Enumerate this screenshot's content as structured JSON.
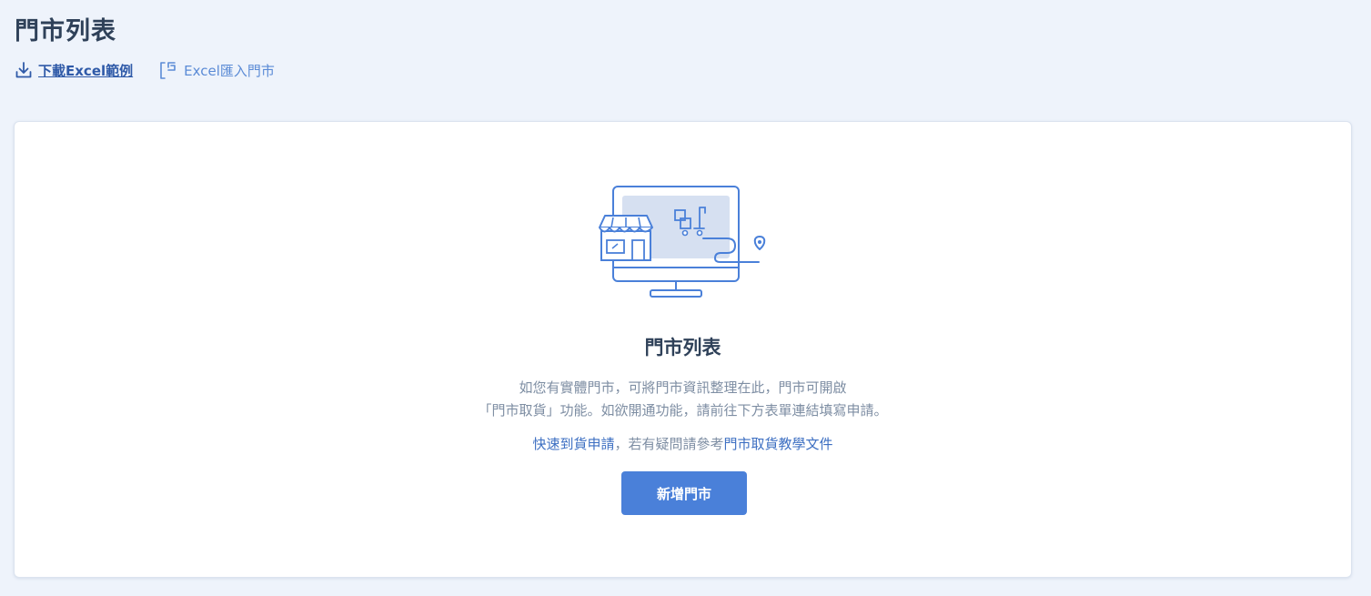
{
  "header": {
    "title": "門市列表"
  },
  "actions": {
    "download_label": "下載Excel範例",
    "import_label": "Excel匯入門市"
  },
  "empty_state": {
    "title": "門市列表",
    "description_line1": "如您有實體門市，可將門市資訊整理在此，門市可開啟",
    "description_line2": "「門市取貨」功能。如欲開通功能，請前往下方表單連結填寫申請。",
    "link_apply": "快速到貨申請",
    "link_separator": "，若有疑問請參考",
    "link_docs": "門市取貨教學文件",
    "add_button": "新增門市"
  },
  "icons": {
    "download": "download-icon",
    "import": "import-icon",
    "illustration": "store-monitor-illustration"
  },
  "colors": {
    "background": "#eef3fb",
    "accent": "#4a80d9",
    "link": "#3d6fc2",
    "title": "#2f4159"
  }
}
